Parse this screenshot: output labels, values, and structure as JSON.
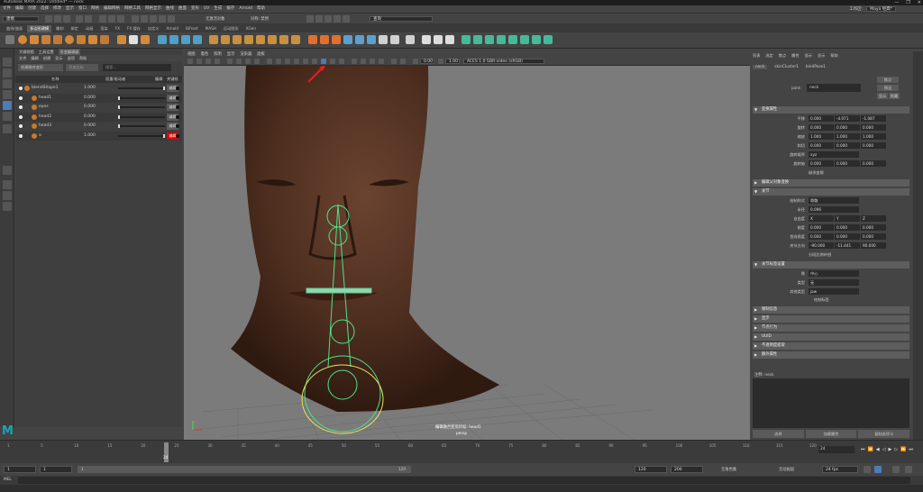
{
  "titlebar": {
    "title": "Autodesk MAYA 2022: Untitled* --- neck",
    "controls": [
      "—",
      "❐",
      "✕"
    ]
  },
  "menubar": {
    "items": [
      "文件",
      "编辑",
      "创建",
      "选择",
      "修改",
      "显示",
      "窗口",
      "网格",
      "编辑网格",
      "网格工具",
      "网格显示",
      "曲线",
      "曲面",
      "变形",
      "UV",
      "生成",
      "缓存",
      "Arnold",
      "帮助"
    ],
    "workspace_label": "工作区:",
    "workspace_value": "Maya 经典*"
  },
  "statusline": {
    "mode": "建模",
    "live_surface": "无激活对象",
    "symmetry": "对称: 禁用",
    "search_placeholder": "查询"
  },
  "shelf": {
    "tabs": [
      "曲线/曲面",
      "多边形建模",
      "雕刻",
      "绑定",
      "动画",
      "渲染",
      "FX",
      "FX 缓存",
      "自定义",
      "Arnold",
      "Bifrost",
      "MASH",
      "运动图形",
      "XGen"
    ],
    "active_tab": 1
  },
  "shape_editor": {
    "tabs": [
      "大纲视图",
      "工具设置",
      "形变编辑器"
    ],
    "menu": [
      "文件",
      "编辑",
      "创建",
      "显示",
      "选项",
      "帮助"
    ],
    "buttons": {
      "create_blendshape": "创建融合变形",
      "add_target": "添加目标"
    },
    "search_placeholder": "搜索...",
    "columns": {
      "name": "名称",
      "weight": "权重/驱动者",
      "edit": "编辑",
      "key": "关键帧"
    },
    "rows": [
      {
        "name": "blendShape1",
        "value": "1.000",
        "slider": 1.0,
        "edit": "编辑",
        "active": false
      },
      {
        "name": "head1",
        "value": "0.000",
        "slider": 0.0,
        "edit": "编辑",
        "active": false
      },
      {
        "name": "eyes",
        "value": "0.000",
        "slider": 0.0,
        "edit": "编辑",
        "active": false
      },
      {
        "name": "head2",
        "value": "0.000",
        "slider": 0.0,
        "edit": "编辑",
        "active": false
      },
      {
        "name": "head3",
        "value": "0.000",
        "slider": 0.0,
        "edit": "编辑",
        "active": false
      },
      {
        "name": "a",
        "value": "1.000",
        "slider": 1.0,
        "edit": "编辑",
        "active": true
      }
    ]
  },
  "viewport": {
    "menu": [
      "视图",
      "着色",
      "照明",
      "显示",
      "渲染器",
      "面板"
    ],
    "exposure": "0.00",
    "gamma": "1.00",
    "colorspace": "ACES 1.0 SDR-video (sRGB)",
    "hud_center": "编辑融合变形目标: head1",
    "camera": "persp"
  },
  "attribute_editor": {
    "menu": [
      "列表",
      "选定",
      "焦点",
      "属性",
      "显示",
      "显示",
      "帮助"
    ],
    "tabs": [
      "neck",
      "skinCluster1",
      "bindPose1"
    ],
    "joint_label": "joint:",
    "joint_value": "neck",
    "focus_btn": "焦点",
    "preset_btn": "预设",
    "show_btn": "显示",
    "hide_btn": "隐藏",
    "sections": {
      "transform": "变换属性",
      "pivot": "编辑父对象变换",
      "joint": "关节",
      "joint_label_sec": "关节标签设置",
      "closed": [
        "限制信息",
        "显示",
        "节点行为",
        "UUID",
        "不透明度提取",
        "额外属性"
      ]
    },
    "transform": [
      {
        "label": "平移",
        "v": [
          "0.000",
          "-4.071",
          "-1.087"
        ]
      },
      {
        "label": "旋转",
        "v": [
          "0.000",
          "0.000",
          "0.000"
        ]
      },
      {
        "label": "缩放",
        "v": [
          "1.000",
          "1.000",
          "1.000"
        ]
      },
      {
        "label": "斜切",
        "v": [
          "0.000",
          "0.000",
          "0.000"
        ]
      },
      {
        "label": "旋转顺序",
        "v": [
          "xyz"
        ]
      },
      {
        "label": "旋转轴",
        "v": [
          "0.000",
          "0.000",
          "0.000"
        ]
      }
    ],
    "inherit_transform": "继承变换",
    "joint": [
      {
        "label": "绘制样式",
        "v": [
          "骨骼"
        ]
      },
      {
        "label": "半径",
        "v": [
          "0.096"
        ]
      },
      {
        "label": "自由度",
        "v": [
          "X",
          "Y",
          "Z"
        ]
      },
      {
        "label": "刚度",
        "v": [
          "0.000",
          "0.000",
          "0.000"
        ]
      },
      {
        "label": "首选角度",
        "v": [
          "0.000",
          "0.000",
          "0.000"
        ]
      },
      {
        "label": "关节方向",
        "v": [
          "-90.000",
          "-11.441",
          "90.000"
        ]
      }
    ],
    "segment_scale": "分段比例补偿",
    "joint_label_rows": [
      {
        "label": "侧",
        "v": [
          "中心"
        ]
      },
      {
        "label": "类型",
        "v": [
          "无"
        ]
      },
      {
        "label": "其他类型",
        "v": [
          "jaw"
        ]
      }
    ],
    "draw_label": "绘制标签",
    "notes_label": "注释: neck",
    "bottom_buttons": [
      "选择",
      "加载属性",
      "复制选项卡"
    ]
  },
  "timeline": {
    "ticks": [
      "1",
      "5",
      "10",
      "15",
      "20",
      "25",
      "30",
      "35",
      "40",
      "45",
      "50",
      "55",
      "60",
      "65",
      "70",
      "75",
      "80",
      "85",
      "90",
      "95",
      "100",
      "105",
      "110",
      "115",
      "120"
    ],
    "current_frame": "24",
    "frame_field": "24"
  },
  "range": {
    "start": "1",
    "start2": "1",
    "playback_start": "1",
    "playback_end": "120",
    "end": "120",
    "anim_end": "200",
    "character_set": "无角色集",
    "anim_layer": "无动画层",
    "fps": "24 fps"
  },
  "cmdline": {
    "label": "MEL"
  }
}
